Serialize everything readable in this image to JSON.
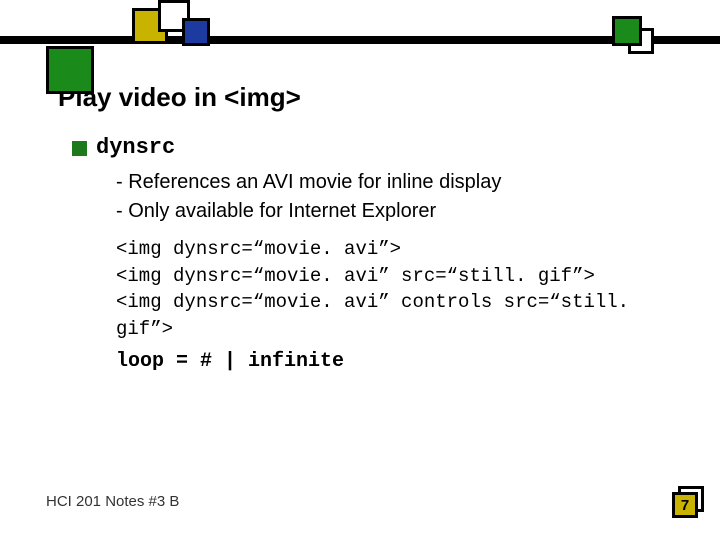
{
  "title": "Play video in <img>",
  "bullet": {
    "label": "dynsrc"
  },
  "subs": [
    "- References an AVI movie for inline display",
    "- Only available for Internet Explorer"
  ],
  "code": [
    "<img dynsrc=“movie. avi”>",
    "<img dynsrc=“movie. avi” src=“still. gif”>",
    "<img dynsrc=“movie. avi” controls src=“still. gif”>"
  ],
  "loop": "loop = # | infinite",
  "footer": "HCI 201 Notes #3 B",
  "page": "7"
}
